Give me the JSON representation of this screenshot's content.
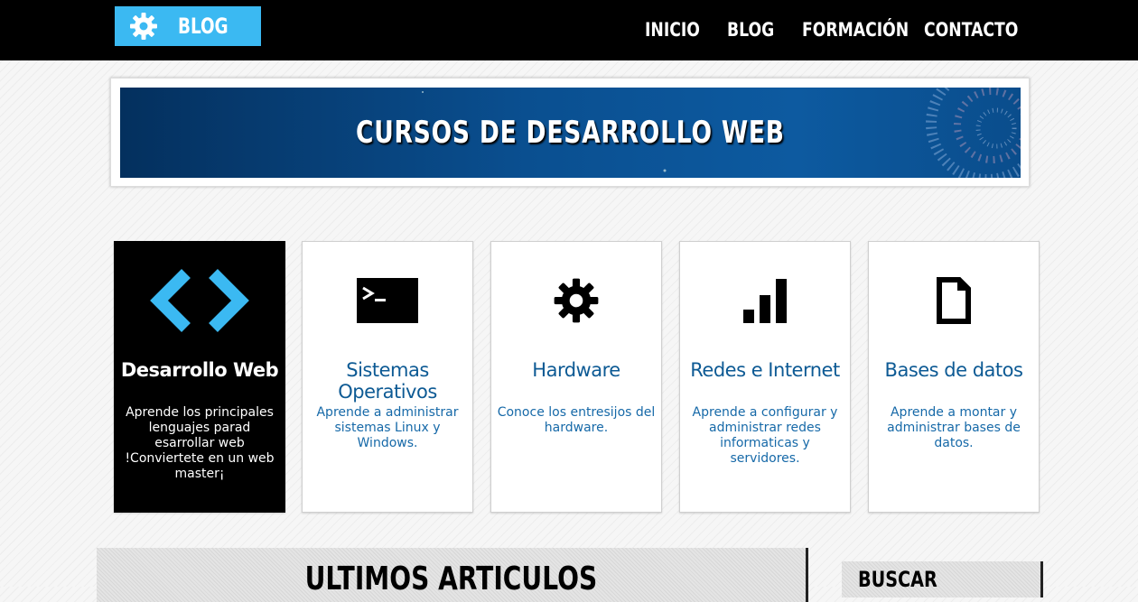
{
  "header": {
    "logo_text": "BLOG",
    "logo_icon": "gear-icon",
    "nav": [
      {
        "label": "INICIO"
      },
      {
        "label": "BLOG"
      },
      {
        "label": "FORMACIÓN"
      },
      {
        "label": "CONTACTO"
      }
    ]
  },
  "banner": {
    "title": "CURSOS DE DESARROLLO WEB"
  },
  "categories": [
    {
      "title": "Desarrollo Web",
      "description": "Aprende los principales lenguajes parad esarrollar web !Conviertete en un web master¡",
      "icon": "code-brackets-icon",
      "active": true
    },
    {
      "title": "Sistemas Operativos",
      "description": "Aprende a administrar sistemas Linux y Windows.",
      "icon": "terminal-icon"
    },
    {
      "title": "Hardware",
      "description": "Conoce los entresijos del hardware.",
      "icon": "gear-icon"
    },
    {
      "title": "Redes e Internet",
      "description": "Aprende a configurar y administrar redes informaticas y servidores.",
      "icon": "signal-bars-icon"
    },
    {
      "title": "Bases de datos",
      "description": "Aprende a montar y administrar bases de datos.",
      "icon": "document-icon"
    }
  ],
  "articles": {
    "title": "ULTIMOS ARTICULOS"
  },
  "sidebar": {
    "search_title": "BUSCAR"
  },
  "colors": {
    "accent": "#3bb9f2",
    "link": "#0d5a94",
    "header_bg": "#000000"
  }
}
